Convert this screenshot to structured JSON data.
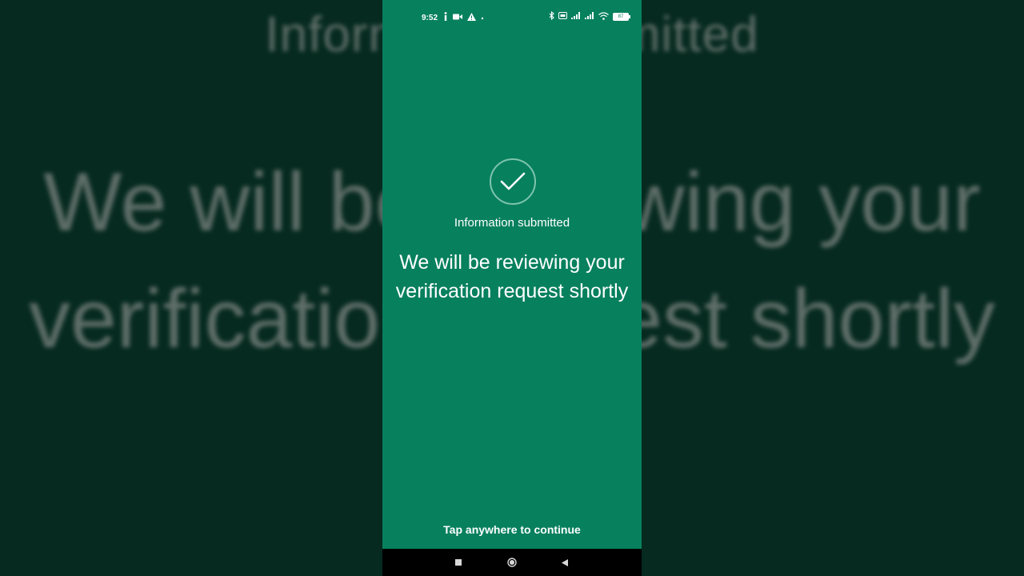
{
  "background": {
    "line1": "Information submitted",
    "line2": "We will be reviewing your verification request shortly"
  },
  "status_bar": {
    "time": "9:52",
    "battery_level": "87",
    "icons_left": [
      "info-icon",
      "video-camera-icon",
      "warning-icon",
      "dot-icon"
    ],
    "icons_right": [
      "bluetooth-icon",
      "volte-icon",
      "signal-icon",
      "signal-icon",
      "wifi-icon",
      "battery-icon"
    ]
  },
  "screen": {
    "status_icon": "check-circle-icon",
    "title": "Information submitted",
    "message": "We will be reviewing your verification request shortly",
    "continue_hint": "Tap anywhere to continue"
  },
  "nav_bar": {
    "buttons": [
      "recents-button",
      "home-button",
      "back-button"
    ]
  },
  "colors": {
    "screen_bg": "#07805e",
    "outer_bg": "#062a1f",
    "text": "#ffffff",
    "check_ring": "#7fc4ad"
  }
}
